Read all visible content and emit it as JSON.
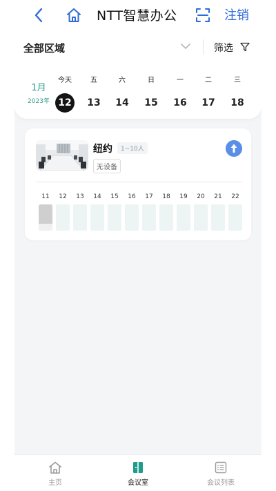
{
  "header": {
    "title": "NTT智慧办公",
    "logout_label": "注销"
  },
  "filter": {
    "area_label": "全部区域",
    "filter_label": "筛选"
  },
  "calendar": {
    "month": "1月",
    "year": "2023年",
    "days": [
      {
        "weekday": "今天",
        "date": "12",
        "selected": true
      },
      {
        "weekday": "五",
        "date": "13"
      },
      {
        "weekday": "六",
        "date": "14"
      },
      {
        "weekday": "日",
        "date": "15"
      },
      {
        "weekday": "一",
        "date": "16"
      },
      {
        "weekday": "二",
        "date": "17"
      },
      {
        "weekday": "三",
        "date": "18"
      }
    ]
  },
  "room": {
    "name": "纽约",
    "capacity": "1~10人",
    "device": "无设备",
    "hours": [
      "11",
      "12",
      "13",
      "14",
      "15",
      "16",
      "17",
      "18",
      "19",
      "20",
      "21",
      "22"
    ]
  },
  "nav": {
    "tabs": [
      {
        "label": "主页",
        "icon": "home-icon"
      },
      {
        "label": "会议室",
        "icon": "door-icon",
        "active": true
      },
      {
        "label": "会议列表",
        "icon": "list-icon"
      }
    ]
  },
  "colors": {
    "accent_blue": "#2f6bd8",
    "accent_teal": "#2e9c8c",
    "slot_free": "#edf5f4",
    "slot_past": "#cfcfcf",
    "action_blue": "#5b8ee6"
  }
}
